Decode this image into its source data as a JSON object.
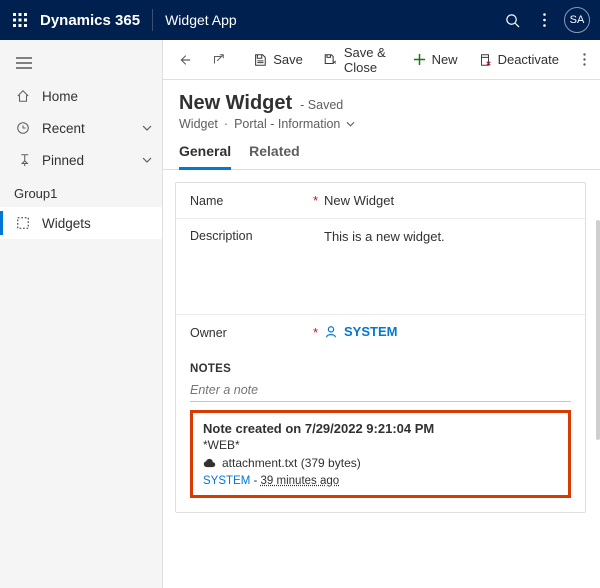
{
  "topbar": {
    "brand": "Dynamics 365",
    "app": "Widget App",
    "avatar": "SA"
  },
  "sidebar": {
    "home": "Home",
    "recent": "Recent",
    "pinned": "Pinned",
    "group": "Group1",
    "widgets": "Widgets"
  },
  "cmdbar": {
    "save": "Save",
    "save_close": "Save & Close",
    "new": "New",
    "deactivate": "Deactivate"
  },
  "header": {
    "title": "New Widget",
    "status": "- Saved",
    "crumb_entity": "Widget",
    "crumb_form": "Portal - Information"
  },
  "tabs": {
    "general": "General",
    "related": "Related"
  },
  "fields": {
    "name_label": "Name",
    "name_value": "New Widget",
    "desc_label": "Description",
    "desc_value": "This is a new widget.",
    "owner_label": "Owner",
    "owner_value": "SYSTEM"
  },
  "notes": {
    "header": "NOTES",
    "placeholder": "Enter a note",
    "title": "Note created on 7/29/2022 9:21:04 PM",
    "source": "*WEB*",
    "attachment": "attachment.txt (379 bytes)",
    "meta_user": "SYSTEM",
    "meta_sep": " - ",
    "meta_ago": "39 minutes ago"
  }
}
